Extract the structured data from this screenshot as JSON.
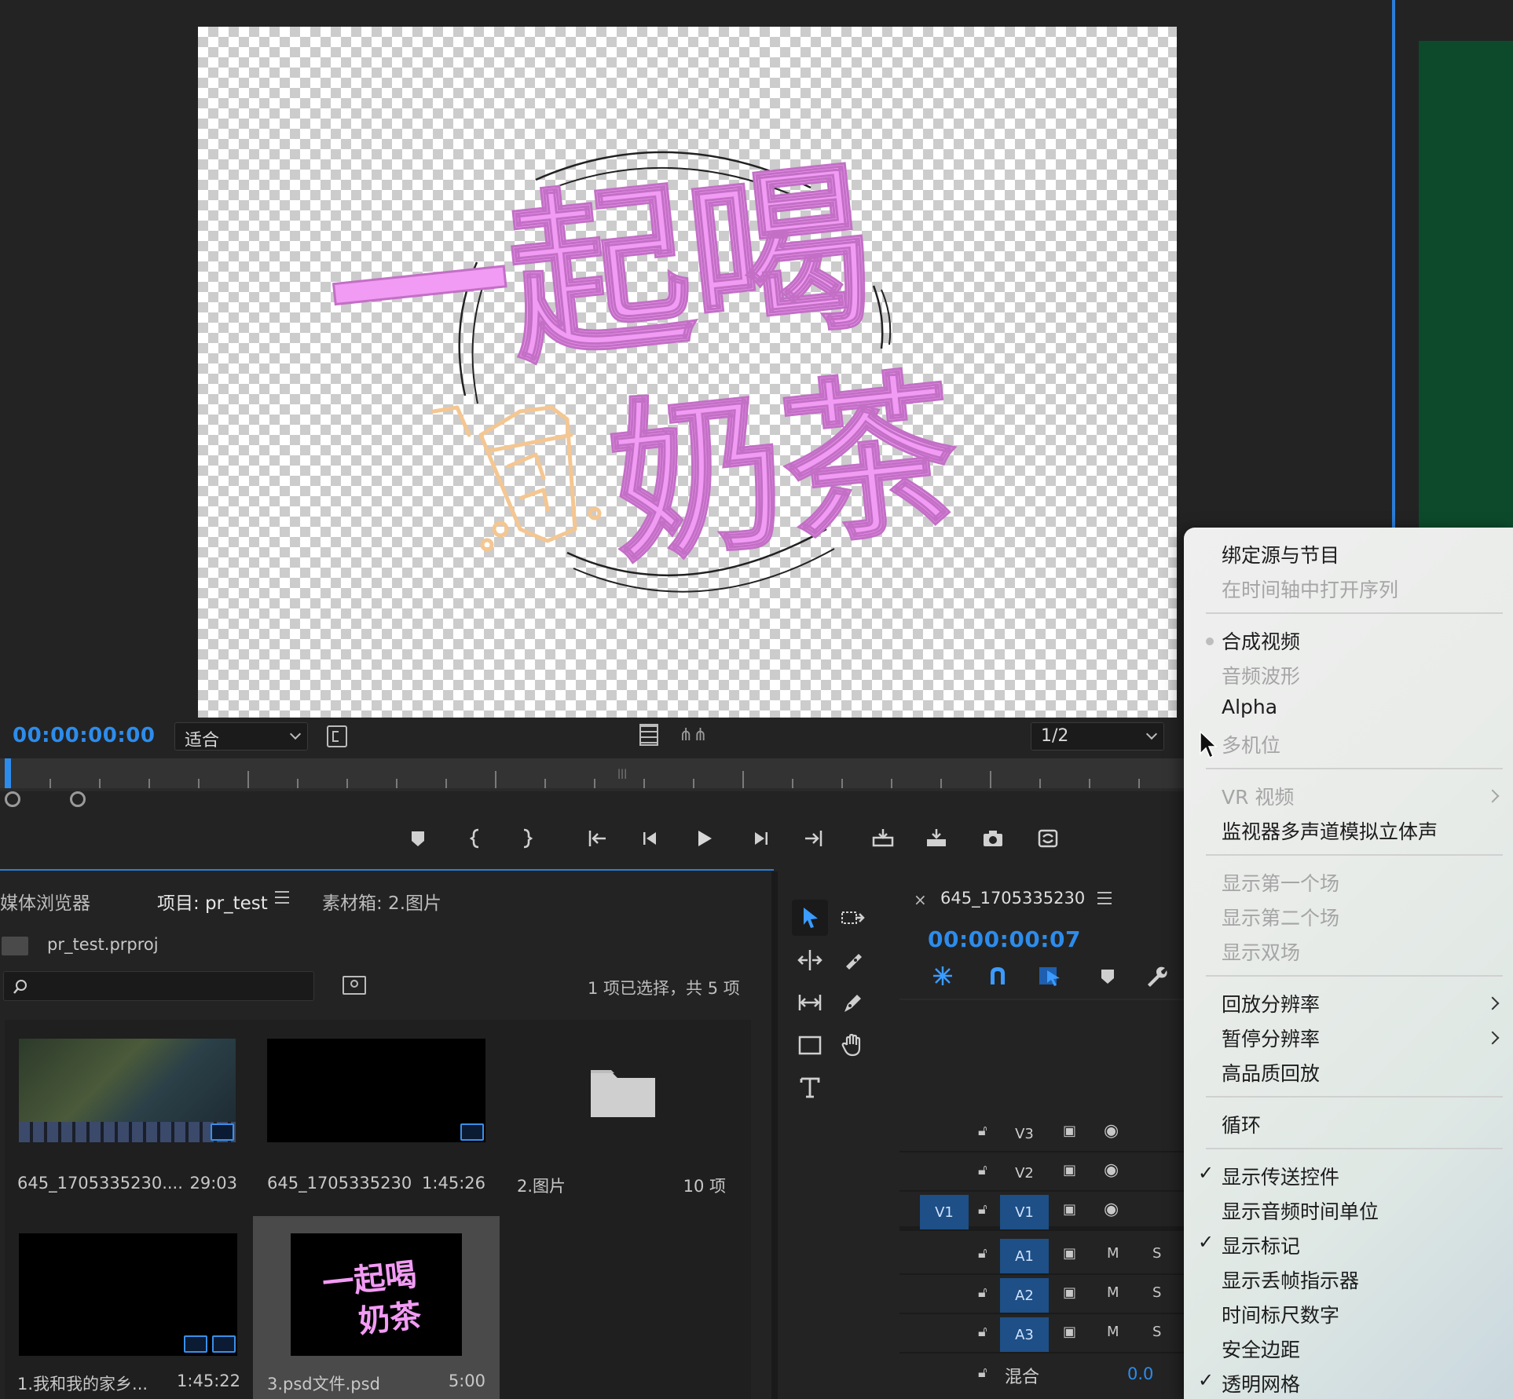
{
  "source_monitor": {
    "timecode": "00:00:00:00",
    "fit_option": "适合",
    "resolution": "1/2"
  },
  "project_panel": {
    "tabs": [
      {
        "label": "媒体浏览器"
      },
      {
        "label": "项目: pr_test"
      },
      {
        "label": "素材箱: 2.图片"
      }
    ],
    "project_file": "pr_test.prproj",
    "search_placeholder": "",
    "selection_status": "1 项已选择，共 5 项",
    "items": [
      {
        "name": "645_1705335230....",
        "duration": "29:03"
      },
      {
        "name": "645_1705335230",
        "duration": "1:45:26"
      },
      {
        "name": "2.图片",
        "duration": "10 项"
      },
      {
        "name": "1.我和我的家乡...",
        "duration": "1:45:22"
      },
      {
        "name": "3.psd文件.psd",
        "duration": "5:00"
      }
    ]
  },
  "timeline": {
    "sequence_name": "645_1705335230",
    "timecode": "00:00:00:07",
    "tracks": {
      "v3": "V3",
      "v2": "V2",
      "v1": "V1",
      "v1_source": "V1",
      "a1": "A1",
      "a2": "A2",
      "a3": "A3",
      "mute": "M",
      "solo": "S"
    },
    "mix_label": "混合",
    "mix_value": "0.0"
  },
  "artwork": {
    "line1": "一起喝",
    "line2": "奶茶"
  },
  "context_menu": {
    "items": [
      {
        "label": "绑定源与节目",
        "enabled": true
      },
      {
        "label": "在时间轴中打开序列",
        "enabled": false
      },
      {
        "label": "合成视频",
        "enabled": true,
        "radio": true
      },
      {
        "label": "音频波形",
        "enabled": false
      },
      {
        "label": "Alpha",
        "enabled": true
      },
      {
        "label": "多机位",
        "enabled": false
      },
      {
        "label": "VR 视频",
        "enabled": false,
        "submenu": true
      },
      {
        "label": "监视器多声道模拟立体声",
        "enabled": true
      },
      {
        "label": "显示第一个场",
        "enabled": false
      },
      {
        "label": "显示第二个场",
        "enabled": false
      },
      {
        "label": "显示双场",
        "enabled": false
      },
      {
        "label": "回放分辨率",
        "enabled": true,
        "submenu": true
      },
      {
        "label": "暂停分辨率",
        "enabled": true,
        "submenu": true
      },
      {
        "label": "高品质回放",
        "enabled": true
      },
      {
        "label": "循环",
        "enabled": true
      },
      {
        "label": "显示传送控件",
        "enabled": true,
        "checked": true
      },
      {
        "label": "显示音频时间单位",
        "enabled": true
      },
      {
        "label": "显示标记",
        "enabled": true,
        "checked": true
      },
      {
        "label": "显示丢帧指示器",
        "enabled": true
      },
      {
        "label": "时间标尺数字",
        "enabled": true
      },
      {
        "label": "安全边距",
        "enabled": true
      },
      {
        "label": "透明网格",
        "enabled": true,
        "checked": true
      }
    ]
  },
  "colors": {
    "accent_blue": "#2d8ceb",
    "artwork_pink": "#f29bf4",
    "artwork_orange": "#f4c691",
    "panel_bg": "#232323"
  }
}
